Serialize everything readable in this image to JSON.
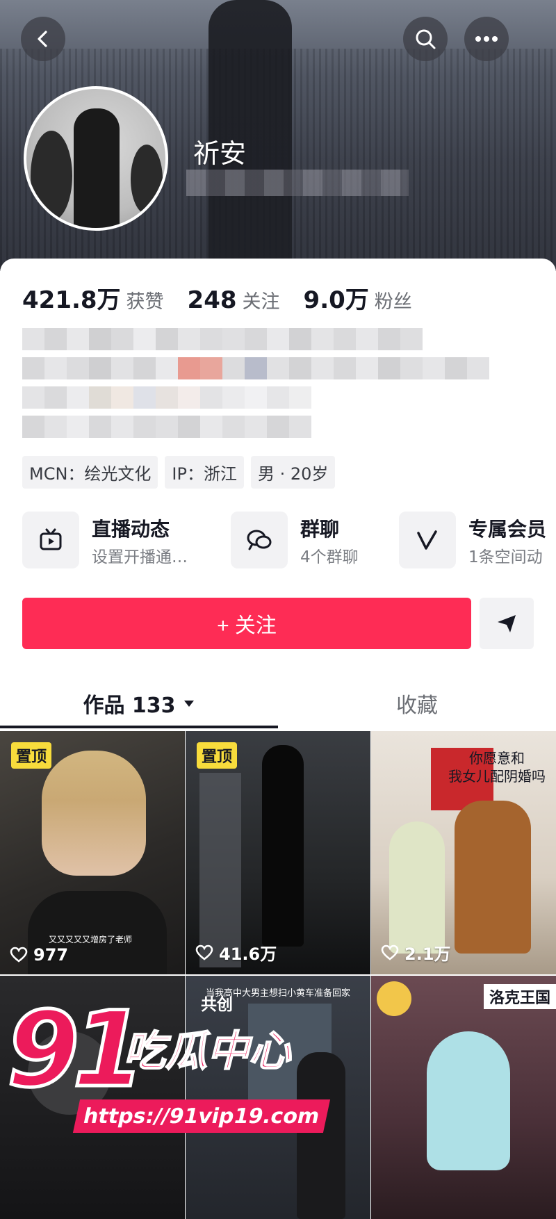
{
  "colors": {
    "accent": "#fe2c55",
    "pin_badge": "#f8dc3c",
    "watermark": "#ec1b5b"
  },
  "header": {
    "back_icon": "chevron-left-icon",
    "search_icon": "search-icon",
    "more_icon": "more-horizontal-icon"
  },
  "profile": {
    "username": "祈安"
  },
  "stats": [
    {
      "value": "421.8万",
      "label": "获赞"
    },
    {
      "value": "248",
      "label": "关注"
    },
    {
      "value": "9.0万",
      "label": "粉丝"
    }
  ],
  "tags": [
    "MCN：绘光文化",
    "IP：浙江",
    "男 · 20岁"
  ],
  "features": [
    {
      "title": "直播动态",
      "subtitle": "设置开播通…",
      "icon": "tv-icon"
    },
    {
      "title": "群聊",
      "subtitle": "4个群聊",
      "icon": "chat-bubbles-icon"
    },
    {
      "title": "专属会员",
      "subtitle": "1条空间动",
      "icon": "v-member-icon"
    }
  ],
  "actions": {
    "follow_label": "+ 关注",
    "share_icon": "send-icon"
  },
  "tabs": {
    "works_label": "作品 133",
    "favorites_label": "收藏"
  },
  "videos": [
    {
      "pinned_label": "置顶",
      "likes": "977",
      "caption": "又又又又又增房了老师"
    },
    {
      "pinned_label": "置顶",
      "likes": "41.6万"
    },
    {
      "likes": "2.1万",
      "overlay_text": "你愿意和\n我女儿配阴婚吗"
    },
    {},
    {
      "cocreate_label": "共创",
      "top_caption": "当我高中大男主想扫小黄车准备回家"
    },
    {
      "badge_text": "洛克王国"
    }
  ],
  "watermark": {
    "number": "91",
    "title": "吃瓜中心",
    "url": "https://91vip19.com"
  }
}
